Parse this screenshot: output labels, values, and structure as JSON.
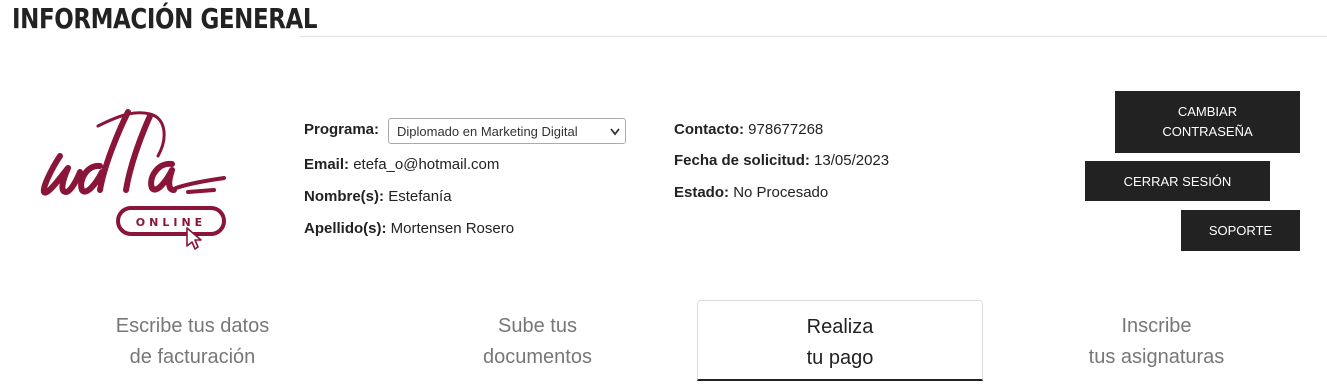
{
  "header": {
    "title": "INFORMACIÓN GENERAL"
  },
  "logo": {
    "wordmark": "udla",
    "badge": "ONLINE",
    "color": "#8a1538"
  },
  "profile": {
    "program_label": "Programa:",
    "program_value": "Diplomado en Marketing Digital",
    "email_label": "Email:",
    "email_value": "etefa_o@hotmail.com",
    "name_label": "Nombre(s):",
    "name_value": "Estefanía",
    "surname_label": "Apellido(s):",
    "surname_value": "Mortensen Rosero",
    "contact_label": "Contacto:",
    "contact_value": "978677268",
    "date_label": "Fecha de solicitud:",
    "date_value": "13/05/2023",
    "status_label": "Estado:",
    "status_value": "No Procesado"
  },
  "actions": {
    "change_password_line1": "CAMBIAR",
    "change_password_line2": "CONTRASEÑA",
    "logout": "CERRAR SESIÓN",
    "support": "SOPORTE"
  },
  "steps": [
    {
      "line1": "Escribe tus datos",
      "line2": "de facturación",
      "active": false
    },
    {
      "line1": "Sube tus",
      "line2": "documentos",
      "active": false
    },
    {
      "line1": "Realiza",
      "line2": "tu pago",
      "active": true
    },
    {
      "line1": "Inscribe",
      "line2": "tus asignaturas",
      "active": false
    }
  ],
  "icons": {
    "select_arrow": "chevron-down-icon",
    "cursor": "pointer-cursor-icon"
  },
  "colors": {
    "brand": "#8a1538",
    "button_bg": "#222222"
  }
}
